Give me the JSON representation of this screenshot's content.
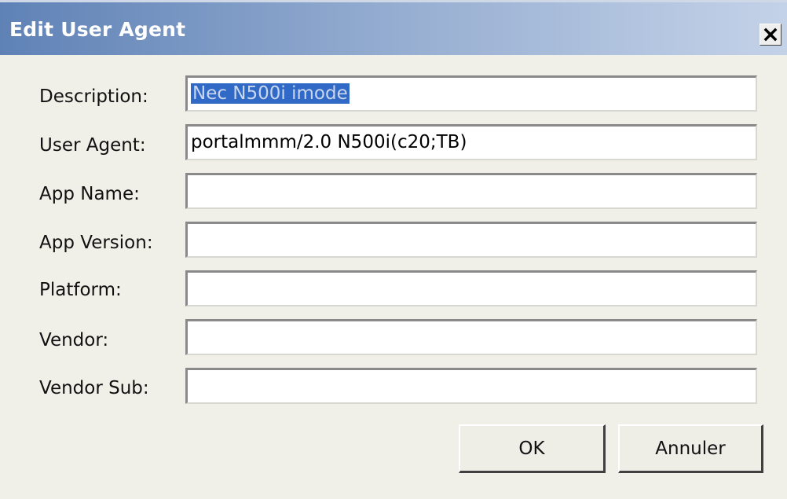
{
  "window": {
    "title": "Edit User Agent",
    "close_icon": "close-x-icon"
  },
  "fields": [
    {
      "label": "Description:",
      "value": "Nec N500i imode",
      "selected": true
    },
    {
      "label": "User Agent:",
      "value": "portalmmm/2.0 N500i(c20;TB)",
      "selected": false
    },
    {
      "label": "App Name:",
      "value": "",
      "selected": false
    },
    {
      "label": "App Version:",
      "value": "",
      "selected": false
    },
    {
      "label": "Platform:",
      "value": "",
      "selected": false
    },
    {
      "label": "Vendor:",
      "value": "",
      "selected": false
    },
    {
      "label": "Vendor Sub:",
      "value": "",
      "selected": false
    }
  ],
  "buttons": {
    "ok_label": "OK",
    "cancel_label": "Annuler"
  },
  "colors": {
    "titlebar_start": "#5f82b6",
    "titlebar_end": "#c4d2e8",
    "selection": "#3169c6",
    "dialog_bg": "#f0efe8"
  }
}
